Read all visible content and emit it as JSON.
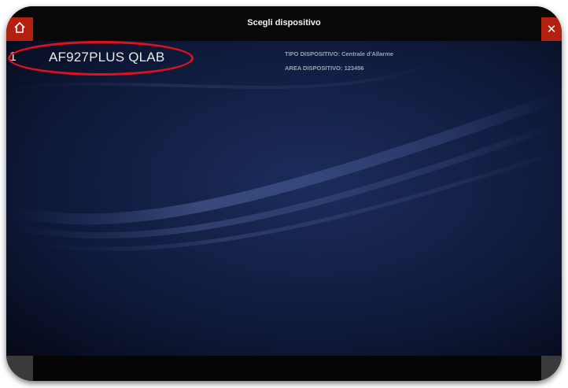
{
  "window": {
    "title": "Scegli dispositivo"
  },
  "toolbar": {
    "home_icon": "home-icon",
    "close_icon": "close-icon",
    "close_glyph": "✕"
  },
  "devices": [
    {
      "index": "1",
      "name": "AF927PLUS QLAB"
    }
  ],
  "details": {
    "type": "TIPO DISPOSITIVO: Centrale d'Allarme",
    "area": "AREA DISPOSITIVO: 123456"
  },
  "colors": {
    "accent": "#b3200f",
    "highlight": "#e0101c",
    "background": "#0c1530"
  }
}
